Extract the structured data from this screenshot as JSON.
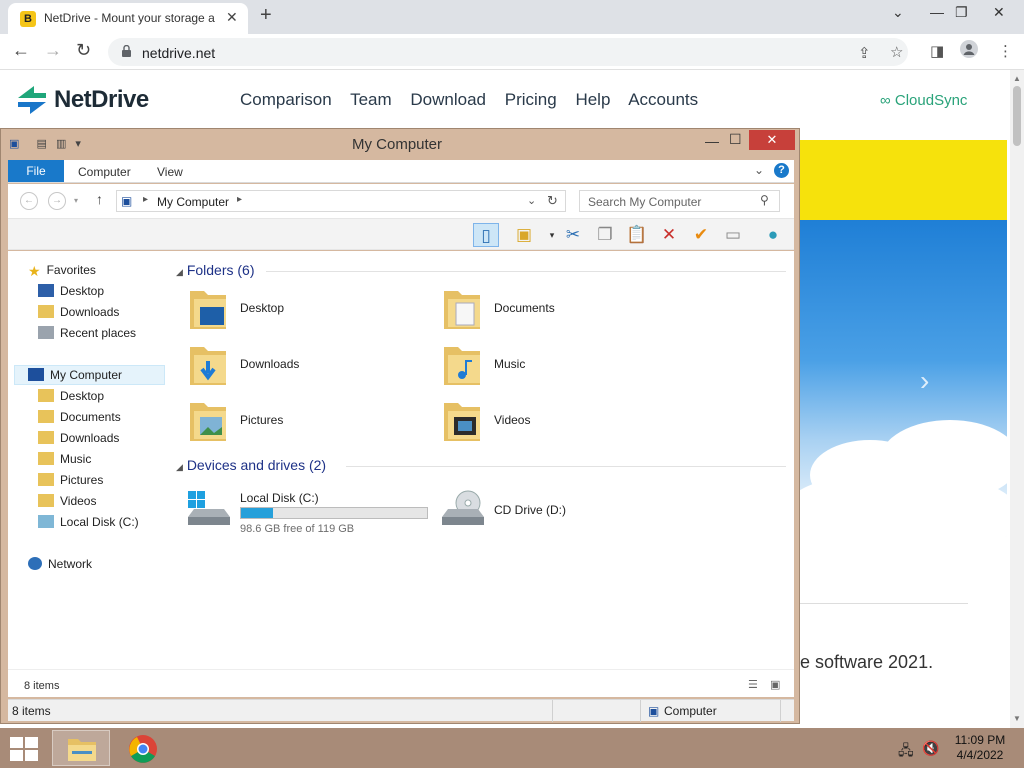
{
  "browser": {
    "tab_title": "NetDrive - Mount your storage a",
    "tab_favicon_letter": "B",
    "url": "netdrive.net"
  },
  "site": {
    "logo_text": "NetDrive",
    "nav": [
      "Comparison",
      "Team",
      "Download",
      "Pricing",
      "Help",
      "Accounts"
    ],
    "cloudsync_text": "CloudSync",
    "body_text": "e software 2021."
  },
  "explorer": {
    "title": "My Computer",
    "ribbon_tabs": {
      "file": "File",
      "computer": "Computer",
      "view": "View"
    },
    "address": "My Computer",
    "search_placeholder": "Search My Computer",
    "nav_pane": {
      "favorites": "Favorites",
      "fav_items": [
        "Desktop",
        "Downloads",
        "Recent places"
      ],
      "my_computer": "My Computer",
      "mc_items": [
        "Desktop",
        "Documents",
        "Downloads",
        "Music",
        "Pictures",
        "Videos",
        "Local Disk (C:)"
      ],
      "network": "Network"
    },
    "folders_header": "Folders (6)",
    "folders": [
      "Desktop",
      "Documents",
      "Downloads",
      "Music",
      "Pictures",
      "Videos"
    ],
    "devices_header": "Devices and drives (2)",
    "drives": {
      "local": {
        "label": "Local Disk (C:)",
        "free_text": "98.6 GB free of 119 GB",
        "used_fraction": 0.17
      },
      "cd": {
        "label": "CD Drive (D:)"
      }
    },
    "inner_status": "8 items",
    "status_count": "8 items",
    "status_zone": "Computer"
  },
  "taskbar": {
    "time": "11:09 PM",
    "date": "4/4/2022"
  },
  "colors": {
    "accent": "#1979ca",
    "window_frame": "#d5b8a0",
    "taskbar": "#a88b78",
    "drive_fill": "#26a0da"
  }
}
